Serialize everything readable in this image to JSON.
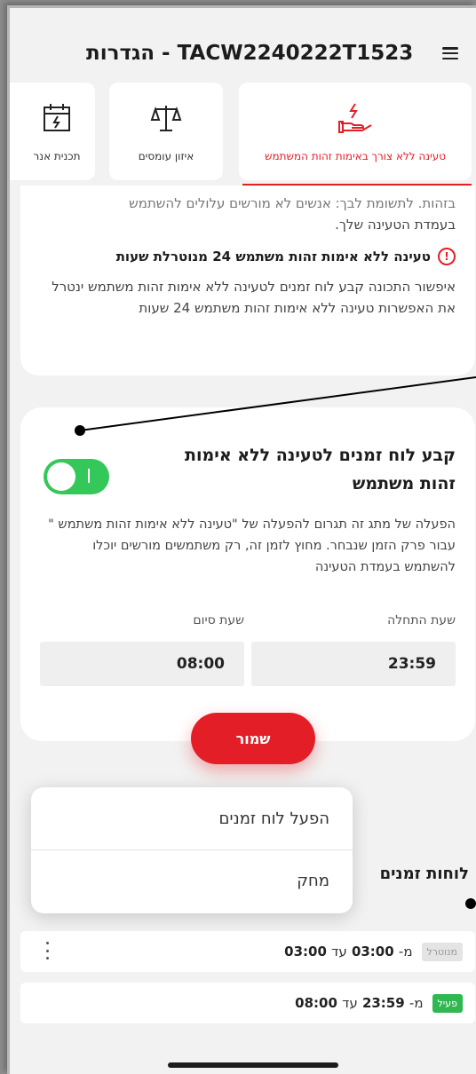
{
  "header": {
    "title": "TACW2240222T1523 - הגדרות"
  },
  "tabs": [
    {
      "label": "טעינה ללא צורך באימות זהות המשתמש",
      "icon": "hand-charging-icon",
      "active": true
    },
    {
      "label": "איזון עומסים",
      "icon": "balance-scale-icon",
      "active": false
    },
    {
      "label": "תכנית אנר",
      "icon": "calendar-charge-icon",
      "active": false
    }
  ],
  "info": {
    "clipped_line": "בזהות. לתשומת לבך: אנשים לא מורשים עלולים להשתמש",
    "clipped_line2": "בעמדת הטעינה שלך.",
    "warning_title": "טעינה ללא אימות זהות משתמש 24 מנוטרלת שעות",
    "warning_desc": "איפשור התכונה קבע לוח זמנים לטעינה ללא אימות זהות משתמש ינטרל את האפשרות טעינה ללא אימות זהות משתמש 24 שעות"
  },
  "schedule": {
    "title": "קבע לוח זמנים לטעינה ללא אימות זהות משתמש",
    "toggle_on": true,
    "description": "הפעלה של מתג זה תגרום להפעלה של \"טעינה ללא אימות זהות משתמש \" עבור פרק הזמן שנבחר. מחוץ לזמן זה, רק משתמשים מורשים יוכלו להשתמש בעמדת הטעינה",
    "start_label": "שעת התחלה",
    "end_label": "שעת סיום",
    "start_value": "23:59",
    "end_value": "08:00",
    "save_label": "שמור"
  },
  "popup": {
    "activate": "הפעל לוח זמנים",
    "delete": "מחק"
  },
  "list": {
    "title": "לוחות זמנים",
    "rows": [
      {
        "status": "מנוטרל",
        "from_prefix": "מ-",
        "from": "03:00",
        "to_prefix": "עד",
        "to": "03:00"
      },
      {
        "status": "פעיל",
        "from_prefix": "מ-",
        "from": "23:59",
        "to_prefix": "עד",
        "to": "08:00"
      }
    ]
  },
  "colors": {
    "accent": "#e41e26",
    "toggle": "#34c759",
    "active_badge": "#2fb84f"
  }
}
